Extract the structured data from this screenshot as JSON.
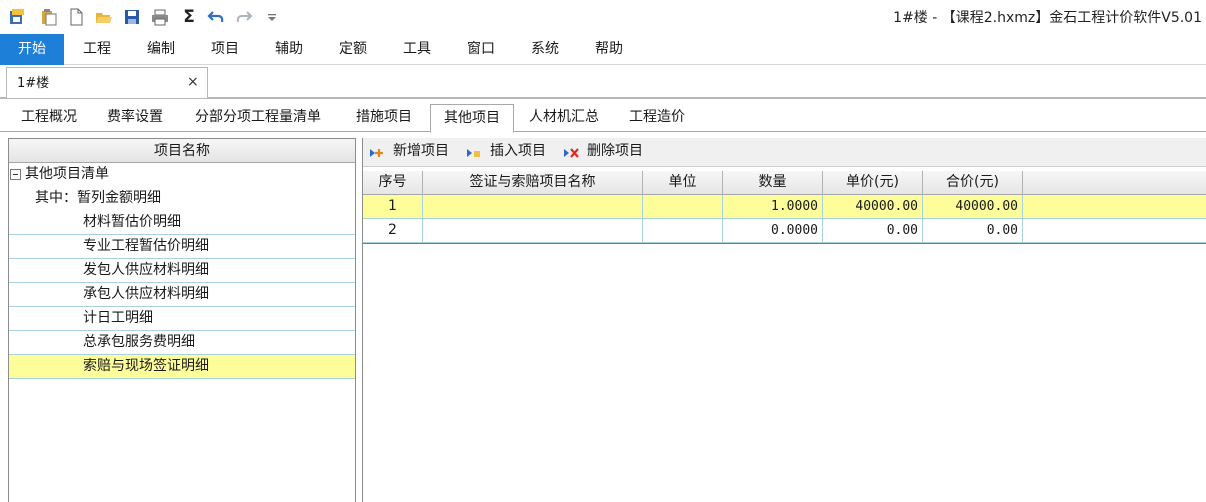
{
  "window": {
    "title": "1#楼 - 【课程2.hxmz】金石工程计价软件V5.01"
  },
  "quick_access": [
    {
      "icon": "app-logo-icon"
    },
    {
      "icon": "paste-icon"
    },
    {
      "icon": "new-file-icon"
    },
    {
      "icon": "open-folder-icon"
    },
    {
      "icon": "save-icon"
    },
    {
      "icon": "print-icon"
    },
    {
      "icon": "sigma-icon",
      "glyph": "Σ"
    },
    {
      "icon": "undo-icon"
    },
    {
      "icon": "redo-icon"
    },
    {
      "icon": "customize-dropdown-icon"
    }
  ],
  "menu": {
    "items": [
      "开始",
      "工程",
      "编制",
      "项目",
      "辅助",
      "定额",
      "工具",
      "窗口",
      "系统",
      "帮助"
    ],
    "active": "开始"
  },
  "doc_tab": {
    "label": "1#楼",
    "close": "×"
  },
  "func_tabs": {
    "items": [
      "工程概况",
      "费率设置",
      "分部分项工程量清单",
      "措施项目",
      "其他项目",
      "人材机汇总",
      "工程造价"
    ],
    "active": "其他项目"
  },
  "tree": {
    "header": "项目名称",
    "items": [
      {
        "label": "其他项目清单",
        "level": 0,
        "expandable": true
      },
      {
        "label": "其中：暂列金额明细",
        "level": 1
      },
      {
        "label": "材料暂估价明细",
        "level": 2
      },
      {
        "label": "专业工程暂估价明细",
        "level": 2
      },
      {
        "label": "发包人供应材料明细",
        "level": 2
      },
      {
        "label": "承包人供应材料明细",
        "level": 2
      },
      {
        "label": "计日工明细",
        "level": 2
      },
      {
        "label": "总承包服务费明细",
        "level": 2
      },
      {
        "label": "索赔与现场签证明细",
        "level": 2,
        "selected": true
      }
    ]
  },
  "toolbar": {
    "add_label": "新增项目",
    "insert_label": "插入项目",
    "delete_label": "删除项目"
  },
  "grid": {
    "columns": [
      "序号",
      "签证与索赔项目名称",
      "单位",
      "数量",
      "单价(元)",
      "合价(元)"
    ],
    "rows": [
      {
        "seq": "1",
        "name": "",
        "unit": "",
        "qty": "1.0000",
        "price": "40000.00",
        "total": "40000.00",
        "selected": true
      },
      {
        "seq": "2",
        "name": "",
        "unit": "",
        "qty": "0.0000",
        "price": "0.00",
        "total": "0.00"
      }
    ]
  },
  "colors": {
    "accent": "#1e7fd8",
    "selection": "#fdfd9a",
    "grid_line": "#a9d2dc"
  }
}
